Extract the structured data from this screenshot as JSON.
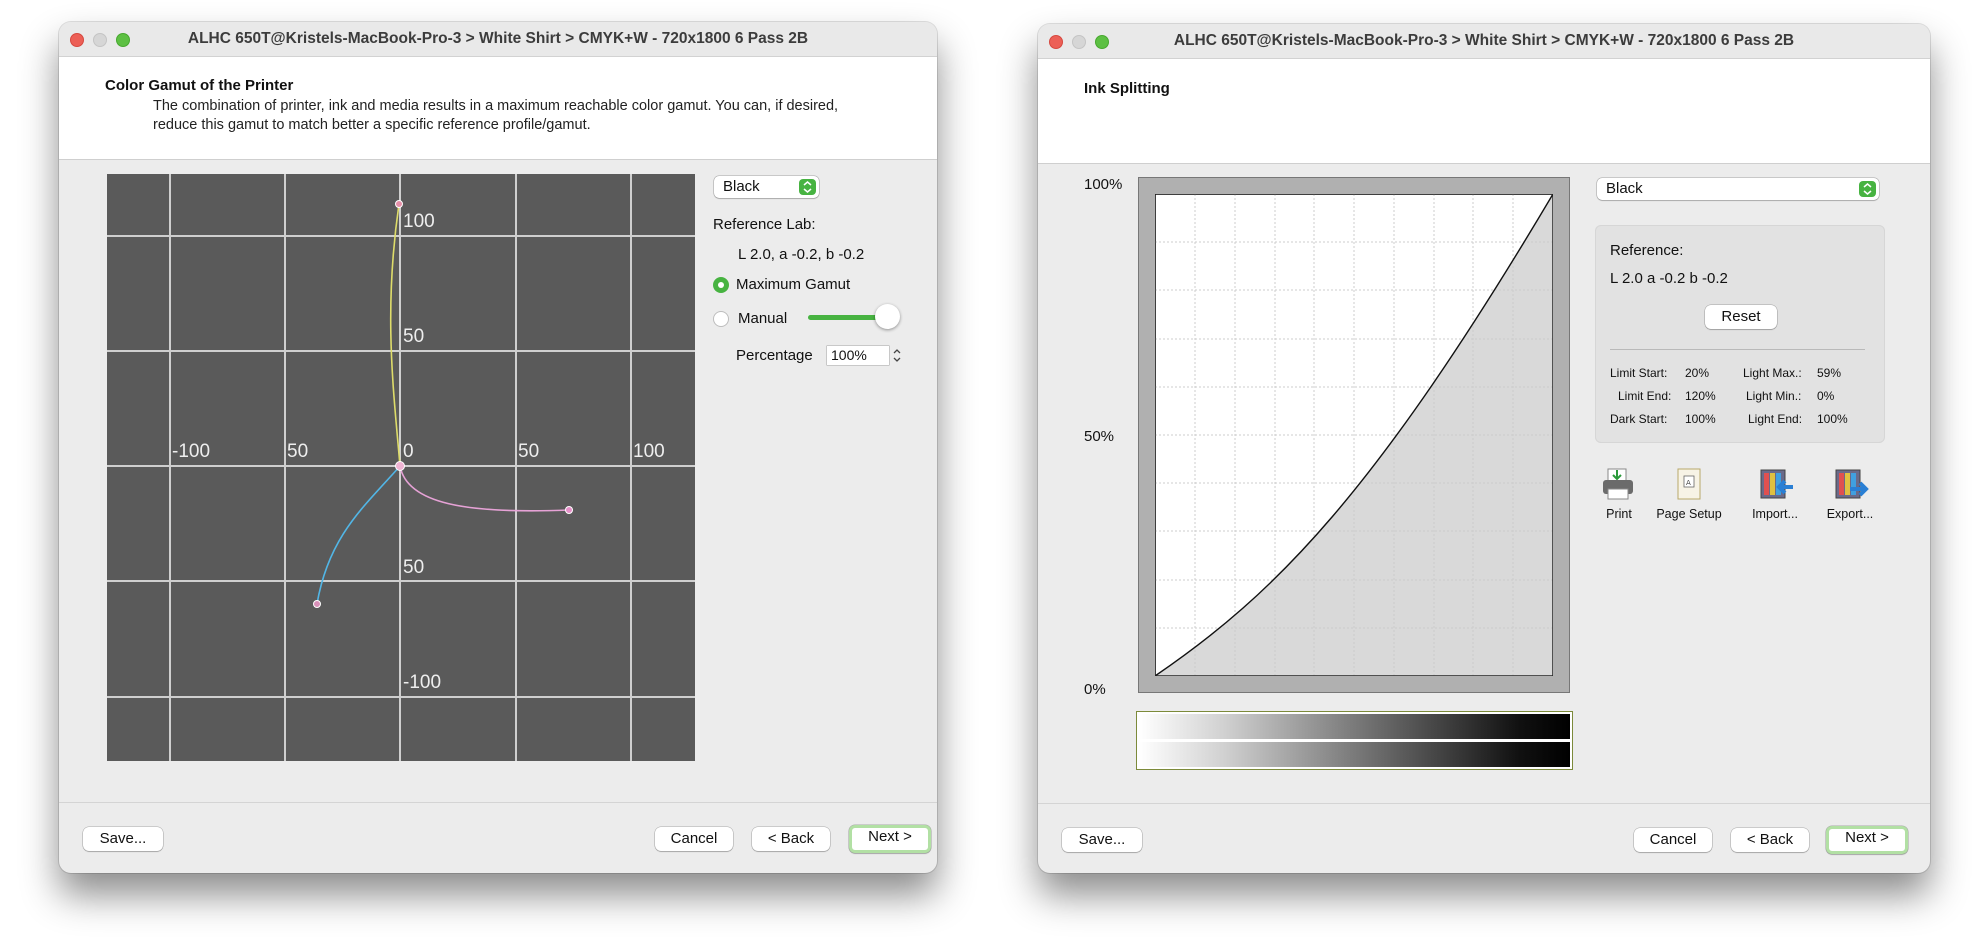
{
  "gamut_window": {
    "title": "ALHC 650T@Kristels-MacBook-Pro-3 > White Shirt > CMYK+W - 720x1800 6 Pass 2B",
    "header_title": "Color Gamut of the Printer",
    "header_desc_line1": "The combination of printer, ink and media results in a maximum reachable color gamut. You can, if desired,",
    "header_desc_line2": "reduce this gamut to match better a specific reference profile/gamut.",
    "plot_labels": {
      "top_100": "100",
      "top_50": "50",
      "center_0": "0",
      "bottom_50": "50",
      "bottom_100": "-100",
      "left_100": "-100",
      "left_50": "50",
      "right_50": "50",
      "right_100": "100"
    },
    "ink_select": "Black",
    "reference_label": "Reference Lab:",
    "reference_value": "L 2.0, a -0.2, b -0.2",
    "max_gamut_label": "Maximum Gamut",
    "manual_label": "Manual",
    "slider_value": 1.0,
    "percentage_label": "Percentage",
    "percentage_value": "100%",
    "save_button": "Save...",
    "cancel_button": "Cancel",
    "back_button": "< Back",
    "next_button": "Next >"
  },
  "ink_window": {
    "title": "ALHC 650T@Kristels-MacBook-Pro-3 > White Shirt > CMYK+W - 720x1800 6 Pass 2B",
    "header_title": "Ink Splitting",
    "y_100": "100%",
    "y_50": "50%",
    "y_0": "0%",
    "ink_select": "Black",
    "reference_label": "Reference:",
    "reference_value": "L 2.0 a -0.2 b -0.2",
    "reset_button": "Reset",
    "params": {
      "limit_start_label": "Limit Start:",
      "limit_start_value": "20%",
      "limit_end_label": "Limit End:",
      "limit_end_value": "120%",
      "dark_start_label": "Dark Start:",
      "dark_start_value": "100%",
      "light_max_label": "Light Max.:",
      "light_max_value": "59%",
      "light_min_label": "Light Min.:",
      "light_min_value": "0%",
      "light_end_label": "Light End:",
      "light_end_value": "100%"
    },
    "tools": {
      "print": "Print",
      "page_setup": "Page Setup",
      "import": "Import...",
      "export": "Export..."
    },
    "save_button": "Save...",
    "cancel_button": "Cancel",
    "back_button": "< Back",
    "next_button": "Next >"
  },
  "colors": {
    "accent_green": "#47b341",
    "plot_bg": "#5a5a5a",
    "close_red": "#ec5f56",
    "zoom_green": "#5dc043"
  }
}
